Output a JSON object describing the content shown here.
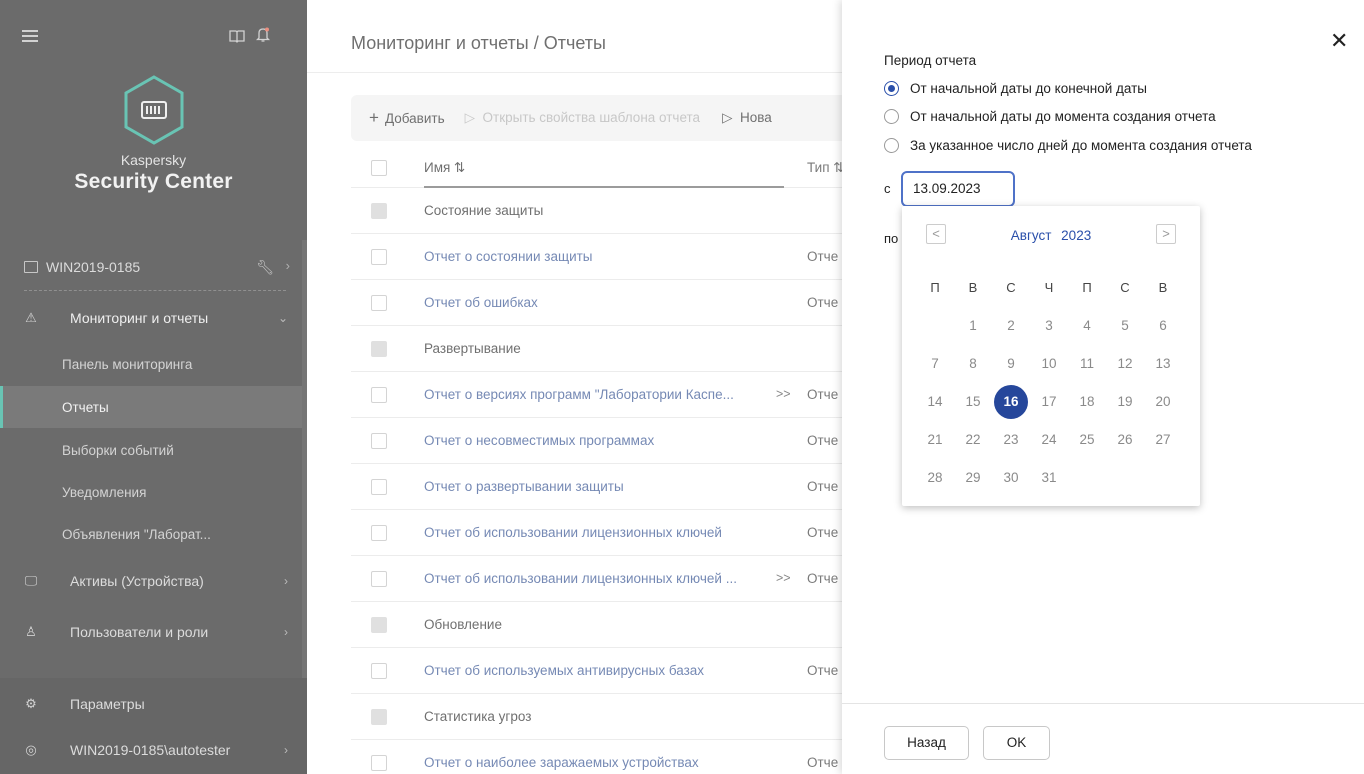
{
  "sidebar": {
    "brand_line1": "Kaspersky",
    "brand_line2": "Security Center",
    "device": "WIN2019-0185",
    "sections": [
      {
        "label": "Мониторинг и отчеты",
        "icon": "warning-triangle-icon",
        "expanded": true
      },
      {
        "label": "Активы (Устройства)",
        "icon": "devices-icon"
      },
      {
        "label": "Пользователи и роли",
        "icon": "users-icon"
      }
    ],
    "subitems": [
      "Панель мониторинга",
      "Отчеты",
      "Выборки событий",
      "Уведомления",
      "Объявления \"Лаборат..."
    ],
    "active_subitem": "Отчеты",
    "footer": [
      {
        "label": "Параметры",
        "icon": "gear-icon"
      },
      {
        "label": "WIN2019-0185\\autotester",
        "icon": "user-circle-icon"
      }
    ],
    "accent": "#1aa58d"
  },
  "main": {
    "breadcrumb": "Мониторинг и отчеты / Отчеты",
    "toolbar": {
      "add": "Добавить",
      "props": "Открыть свойства шаблона отчета",
      "new": "Нова"
    },
    "columns": {
      "name": "Имя ⇅",
      "type": "Тип ⇅"
    },
    "rows": [
      {
        "name": "Состояние защиты",
        "group": true,
        "type": ""
      },
      {
        "name": "Отчет о состоянии защиты",
        "group": false,
        "type": "Отче"
      },
      {
        "name": "Отчет об ошибках",
        "group": false,
        "type": "Отче"
      },
      {
        "name": "Развертывание",
        "group": true,
        "type": ""
      },
      {
        "name": "Отчет о версиях программ \"Лаборатории Каспе...",
        "group": false,
        "type": "Отче",
        "more": ">>"
      },
      {
        "name": "Отчет о несовместимых программах",
        "group": false,
        "type": "Отче"
      },
      {
        "name": "Отчет о развертывании защиты",
        "group": false,
        "type": "Отче"
      },
      {
        "name": "Отчет об использовании лицензионных ключей",
        "group": false,
        "type": "Отче"
      },
      {
        "name": "Отчет об использовании лицензионных ключей ...",
        "group": false,
        "type": "Отче",
        "more": ">>"
      },
      {
        "name": "Обновление",
        "group": true,
        "type": ""
      },
      {
        "name": "Отчет об используемых антивирусных базах",
        "group": false,
        "type": "Отче"
      },
      {
        "name": "Статистика угроз",
        "group": true,
        "type": ""
      },
      {
        "name": "Отчет о наиболее заражаемых устройствах",
        "group": false,
        "type": "Отче"
      }
    ]
  },
  "panel": {
    "title": "Период отчета",
    "options": [
      {
        "label": "От начальной даты до конечной даты",
        "selected": true
      },
      {
        "label": "От начальной даты до момента создания отчета",
        "selected": false
      },
      {
        "label": "За указанное число дней до момента создания отчета",
        "selected": false
      }
    ],
    "from_label": "с",
    "from_value": "13.09.2023",
    "to_label": "по",
    "calendar": {
      "month": "Август",
      "year": "2023",
      "weekdays": [
        "П",
        "В",
        "С",
        "Ч",
        "П",
        "С",
        "В"
      ],
      "first_weekday_index": 1,
      "days": [
        "1",
        "2",
        "3",
        "4",
        "5",
        "6",
        "7",
        "8",
        "9",
        "10",
        "11",
        "12",
        "13",
        "14",
        "15",
        "16",
        "17",
        "18",
        "19",
        "20",
        "21",
        "22",
        "23",
        "24",
        "25",
        "26",
        "27",
        "28",
        "29",
        "30",
        "31"
      ],
      "selected_day": "16",
      "prev": "<",
      "next": ">"
    },
    "buttons": {
      "back": "Назад",
      "ok": "OK"
    },
    "close": "✕",
    "accent": "#26479b"
  }
}
